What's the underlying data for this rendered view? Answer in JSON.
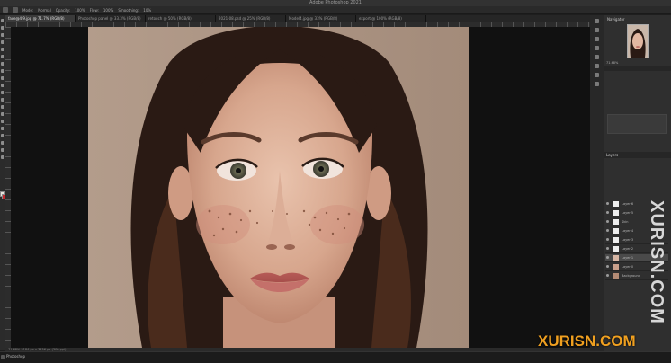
{
  "window": {
    "title": "Adobe Photoshop 2021"
  },
  "options_bar": {
    "items": [
      "Mode:",
      "Normal",
      "Opacity:",
      "100%",
      "Flow:",
      "100%",
      "Smoothing:",
      "10%"
    ]
  },
  "tabs": [
    {
      "label": "face@4.9.jpg @ 71.7% (RGB/8)"
    },
    {
      "label": "Photoshop panel @ 33.3% (RGB/8)"
    },
    {
      "label": "retouch @ 50% (RGB/8)"
    },
    {
      "label": "2021-08.psd @ 25% (RGB/8)"
    },
    {
      "label": "Model4.jpg @ 33% (RGB/8)"
    },
    {
      "label": "export @ 100% (RGB/8)"
    }
  ],
  "status": {
    "text": "71.68%   5184 px x 3456 px (300 ppi)"
  },
  "dock": {
    "app_label": "Photoshop"
  },
  "panels": {
    "navigator_title": "Navigator",
    "zoom": "71.68%",
    "layers_title": "Layers",
    "layers": [
      {
        "name": "Layer 6"
      },
      {
        "name": "Layer 5"
      },
      {
        "name": "Skin"
      },
      {
        "name": "Layer 4"
      },
      {
        "name": "Layer 3"
      },
      {
        "name": "Layer 2"
      },
      {
        "name": "Layer 1"
      },
      {
        "name": "Layer 0"
      },
      {
        "name": "Background"
      }
    ]
  },
  "watermark": {
    "vertical": "XURISN.COM",
    "horizontal": "XURISN.COM"
  },
  "colors": {
    "foreground": "#e7e2dc",
    "background": "#c3262b",
    "watermark": "#f0a020"
  }
}
